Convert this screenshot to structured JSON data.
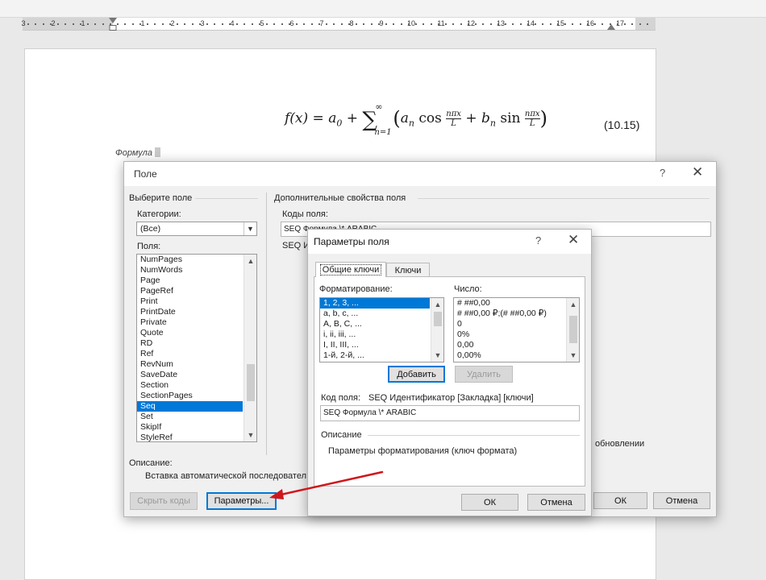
{
  "ruler": {
    "numbers": [
      "3",
      "2",
      "1",
      "1",
      "2",
      "3",
      "4",
      "5",
      "6",
      "7",
      "8",
      "9",
      "10",
      "11",
      "12",
      "13",
      "14",
      "15",
      "16",
      "17"
    ]
  },
  "document": {
    "formula_lhs": "f(x) = a",
    "formula_sum_upper": "∞",
    "formula_sum_lower": "n=1",
    "equation_number": "(10.15)",
    "caption_text": "Формула"
  },
  "field_dialog": {
    "title": "Поле",
    "help": "?",
    "close": "✕",
    "choose_field_label": "Выберите поле",
    "categories_label": "Категории:",
    "category_value": "(Все)",
    "fields_label": "Поля:",
    "fields": [
      "NumPages",
      "NumWords",
      "Page",
      "PageRef",
      "Print",
      "PrintDate",
      "Private",
      "Quote",
      "RD",
      "Ref",
      "RevNum",
      "SaveDate",
      "Section",
      "SectionPages",
      "Seq",
      "Set",
      "SkipIf",
      "StyleRef"
    ],
    "selected_field": "Seq",
    "extra_props_label": "Дополнительные свойства поля",
    "field_codes_label": "Коды поля:",
    "field_codes_value": "SEQ Формула \\* ARABIC",
    "field_codes_hint_partial": "SEQ И",
    "update_option_partial": "обновлении",
    "description_label": "Описание:",
    "description_text": "Вставка автоматической последовател",
    "hide_codes_button": "Скрыть коды",
    "options_button": "Параметры...",
    "ok_button": "ОК",
    "cancel_button": "Отмена"
  },
  "options_dialog": {
    "title": "Параметры поля",
    "help": "?",
    "close": "✕",
    "tabs": [
      "Общие ключи",
      "Ключи"
    ],
    "formatting_label": "Форматирование:",
    "formatting_items": [
      "1, 2, 3, ...",
      "a, b, c, ...",
      "A, B, C, ...",
      "i, ii, iii, ...",
      "I, II, III, ...",
      "1-й, 2-й, ..."
    ],
    "number_label": "Число:",
    "number_items": [
      "# ##0,00",
      "# ##0,00 ₽;(# ##0,00 ₽)",
      "0",
      "0%",
      "0,00",
      "0,00%"
    ],
    "add_button": "Добавить",
    "remove_button": "Удалить",
    "field_code_label": "Код поля:",
    "field_code_syntax": "SEQ Идентификатор [Закладка] [ключи]",
    "field_code_value": "SEQ Формула \\* ARABIC",
    "description_label": "Описание",
    "description_text": "Параметры форматирования (ключ формата)",
    "ok_button": "ОК",
    "cancel_button": "Отмена"
  },
  "colors": {
    "accent": "#0078d7",
    "arrow": "#d0161b"
  }
}
